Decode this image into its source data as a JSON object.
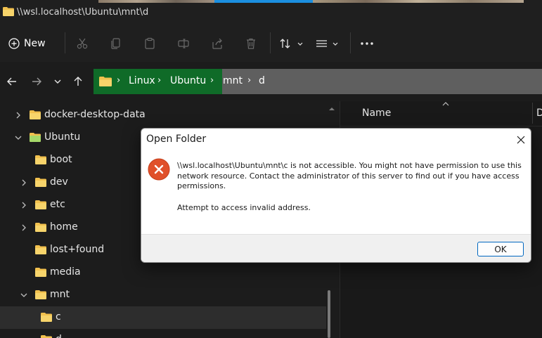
{
  "window": {
    "title": "\\\\wsl.localhost\\Ubuntu\\mnt\\d"
  },
  "toolbar": {
    "new_label": "New",
    "icons": [
      "plus-circle-icon",
      "cut-icon",
      "copy-icon",
      "paste-icon",
      "rename-icon",
      "share-icon",
      "delete-icon",
      "sort-icon",
      "view-icon",
      "more-icon"
    ]
  },
  "address": {
    "crumbs": [
      "Linux",
      "Ubuntu",
      "mnt",
      "d"
    ]
  },
  "tree": {
    "items": [
      {
        "label": "docker-desktop-data",
        "expander": "right"
      },
      {
        "label": "Ubuntu",
        "expander": "down"
      },
      {
        "label": "boot",
        "expander": "none"
      },
      {
        "label": "dev",
        "expander": "right"
      },
      {
        "label": "etc",
        "expander": "right"
      },
      {
        "label": "home",
        "expander": "right"
      },
      {
        "label": "lost+found",
        "expander": "none"
      },
      {
        "label": "media",
        "expander": "none"
      },
      {
        "label": "mnt",
        "expander": "down"
      },
      {
        "label": "c",
        "expander": "none",
        "selected": true
      },
      {
        "label": "d",
        "expander": "none"
      }
    ]
  },
  "file_list": {
    "column_name": "Name",
    "next_column_initial": "D"
  },
  "dialog": {
    "title": "Open Folder",
    "message": "\\\\wsl.localhost\\Ubuntu\\mnt\\c is not accessible. You might not have permission to use this network resource. Contact the administrator of this server to find out if you have access permissions.",
    "detail": "Attempt to access invalid address.",
    "ok_label": "OK"
  },
  "colors": {
    "folder": "#f2c14e",
    "address_highlight": "#0f6b28",
    "error": "#e0502a",
    "accent": "#0067c0"
  }
}
